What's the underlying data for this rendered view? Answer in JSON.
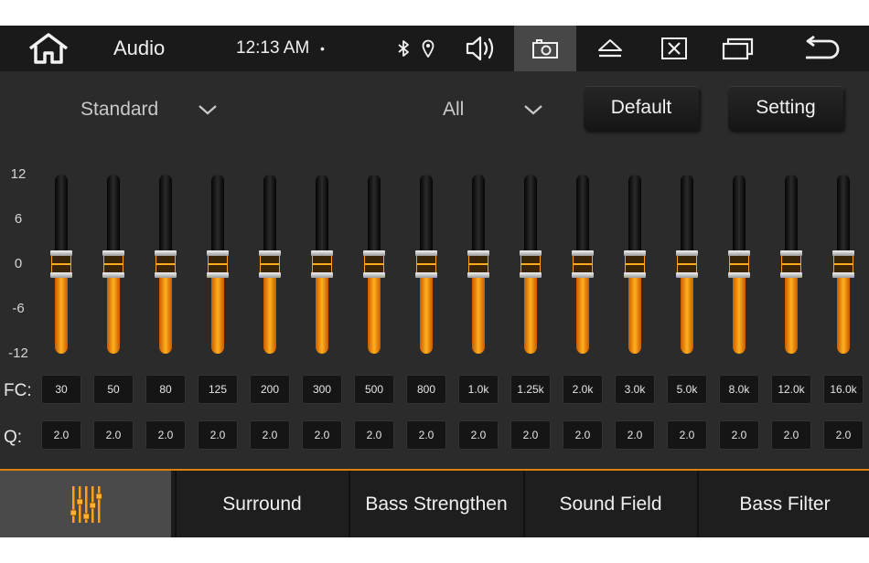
{
  "status_bar": {
    "app_title": "Audio",
    "clock": "12:13 AM",
    "indicator": "•",
    "icons": [
      "home-icon",
      "bluetooth-icon",
      "location-icon",
      "volume-icon",
      "camera-icon",
      "eject-icon",
      "close-icon",
      "recent-apps-icon",
      "back-icon"
    ]
  },
  "controls": {
    "preset": "Standard",
    "channel": "All",
    "default_label": "Default",
    "setting_label": "Setting"
  },
  "eq": {
    "scale": [
      "12",
      "6",
      "0",
      "-6",
      "-12"
    ],
    "fc_label": "FC:",
    "q_label": "Q:",
    "bands": [
      {
        "fc": "30",
        "q": "2.0",
        "gain": 0
      },
      {
        "fc": "50",
        "q": "2.0",
        "gain": 0
      },
      {
        "fc": "80",
        "q": "2.0",
        "gain": 0
      },
      {
        "fc": "125",
        "q": "2.0",
        "gain": 0
      },
      {
        "fc": "200",
        "q": "2.0",
        "gain": 0
      },
      {
        "fc": "300",
        "q": "2.0",
        "gain": 0
      },
      {
        "fc": "500",
        "q": "2.0",
        "gain": 0
      },
      {
        "fc": "800",
        "q": "2.0",
        "gain": 0
      },
      {
        "fc": "1.0k",
        "q": "2.0",
        "gain": 0
      },
      {
        "fc": "1.25k",
        "q": "2.0",
        "gain": 0
      },
      {
        "fc": "2.0k",
        "q": "2.0",
        "gain": 0
      },
      {
        "fc": "3.0k",
        "q": "2.0",
        "gain": 0
      },
      {
        "fc": "5.0k",
        "q": "2.0",
        "gain": 0
      },
      {
        "fc": "8.0k",
        "q": "2.0",
        "gain": 0
      },
      {
        "fc": "12.0k",
        "q": "2.0",
        "gain": 0
      },
      {
        "fc": "16.0k",
        "q": "2.0",
        "gain": 0
      }
    ]
  },
  "tabs": [
    {
      "label": "",
      "icon": "equalizer-icon",
      "active": true
    },
    {
      "label": "Surround",
      "active": false
    },
    {
      "label": "Bass Strengthen",
      "active": false
    },
    {
      "label": "Sound Field",
      "active": false
    },
    {
      "label": "Bass Filter",
      "active": false
    }
  ],
  "colors": {
    "accent": "#ff9f1a",
    "background": "#2b2b2b",
    "status_bar": "#1a1a1a"
  }
}
